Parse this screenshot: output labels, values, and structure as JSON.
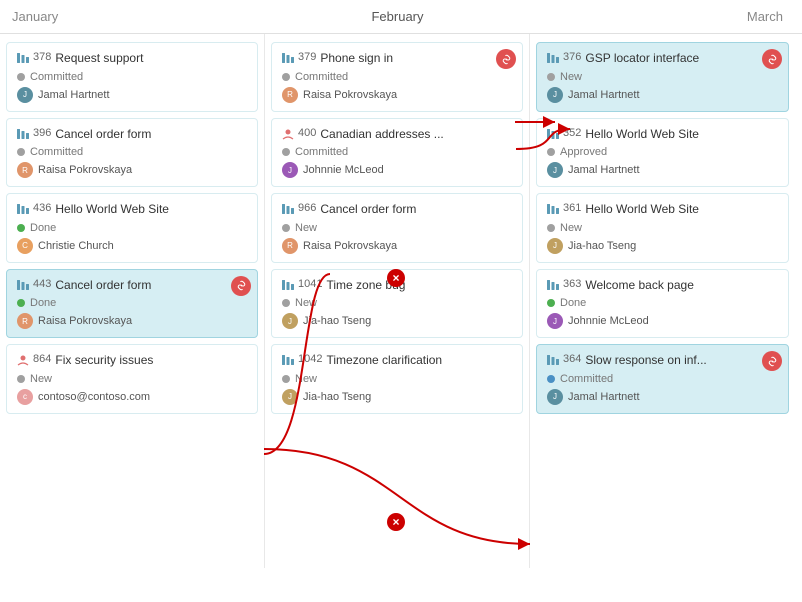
{
  "header": {
    "january": "January",
    "february": "February",
    "march": "March"
  },
  "columns": {
    "january": {
      "cards": [
        {
          "id": "378",
          "name": "Request support",
          "status": "Committed",
          "statusClass": "committed",
          "person": "Jamal Hartnett",
          "avatarClass": "jamal",
          "highlighted": false,
          "hasLink": false
        },
        {
          "id": "396",
          "name": "Cancel order form",
          "status": "Committed",
          "statusClass": "committed",
          "person": "Raisa Pokrovskaya",
          "avatarClass": "raisa",
          "highlighted": false,
          "hasLink": false
        },
        {
          "id": "436",
          "name": "Hello World Web Site",
          "status": "Done",
          "statusClass": "done",
          "person": "Christie Church",
          "avatarClass": "christie",
          "highlighted": false,
          "hasLink": false
        },
        {
          "id": "443",
          "name": "Cancel order form",
          "status": "Done",
          "statusClass": "done",
          "person": "Raisa Pokrovskaya",
          "avatarClass": "raisa",
          "highlighted": true,
          "hasLink": true
        },
        {
          "id": "864",
          "name": "Fix security issues",
          "status": "New",
          "statusClass": "new",
          "person": "contoso@contoso.com",
          "avatarClass": "contoso",
          "highlighted": false,
          "hasLink": false
        }
      ]
    },
    "february": {
      "cards": [
        {
          "id": "379",
          "name": "Phone sign in",
          "status": "Committed",
          "statusClass": "committed",
          "person": "Raisa Pokrovskaya",
          "avatarClass": "raisa",
          "highlighted": false,
          "hasLink": true
        },
        {
          "id": "400",
          "name": "Canadian addresses ...",
          "status": "Committed",
          "statusClass": "committed",
          "person": "Johnnie McLeod",
          "avatarClass": "johnnie",
          "highlighted": false,
          "hasLink": false
        },
        {
          "id": "966",
          "name": "Cancel order form",
          "status": "New",
          "statusClass": "new",
          "person": "Raisa Pokrovskaya",
          "avatarClass": "raisa",
          "highlighted": false,
          "hasLink": false
        },
        {
          "id": "1041",
          "name": "Time zone bug",
          "status": "New",
          "statusClass": "new",
          "person": "Jia-hao Tseng",
          "avatarClass": "jiahao",
          "highlighted": false,
          "hasLink": false
        },
        {
          "id": "1042",
          "name": "Timezone clarification",
          "status": "New",
          "statusClass": "new",
          "person": "Jia-hao Tseng",
          "avatarClass": "jiahao",
          "highlighted": false,
          "hasLink": false
        }
      ]
    },
    "march": {
      "cards": [
        {
          "id": "376",
          "name": "GSP locator interface",
          "status": "New",
          "statusClass": "new",
          "person": "Jamal Hartnett",
          "avatarClass": "jamal",
          "highlighted": true,
          "hasLink": true
        },
        {
          "id": "352",
          "name": "Hello World Web Site",
          "status": "Approved",
          "statusClass": "approved",
          "person": "Jamal Hartnett",
          "avatarClass": "jamal",
          "highlighted": false,
          "hasLink": false
        },
        {
          "id": "361",
          "name": "Hello World Web Site",
          "status": "New",
          "statusClass": "new",
          "person": "Jia-hao Tseng",
          "avatarClass": "jiahao",
          "highlighted": false,
          "hasLink": false
        },
        {
          "id": "363",
          "name": "Welcome back page",
          "status": "Done",
          "statusClass": "done",
          "person": "Johnnie McLeod",
          "avatarClass": "johnnie",
          "highlighted": false,
          "hasLink": false
        },
        {
          "id": "364",
          "name": "Slow response on inf...",
          "status": "Committed",
          "statusClass": "committed",
          "person": "Jamal Hartnett",
          "avatarClass": "jamal",
          "highlighted": true,
          "hasLink": true
        }
      ]
    }
  }
}
